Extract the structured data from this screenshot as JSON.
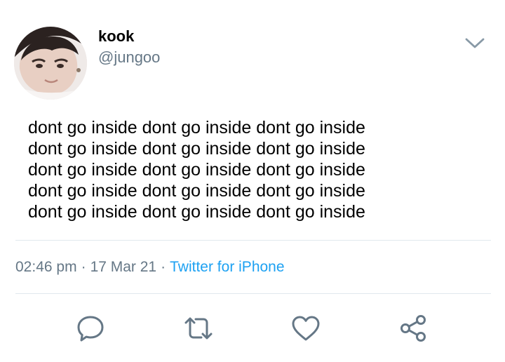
{
  "user": {
    "display_name": "kook",
    "handle": "@jungoo"
  },
  "tweet": {
    "lines": [
      "dont go inside dont go inside dont go inside",
      "dont go inside dont go inside dont go inside",
      "dont go inside dont go inside dont go inside",
      "dont go inside dont go inside dont go inside",
      "dont go inside dont go inside dont go inside"
    ],
    "time": "02:46 pm",
    "date": "17 Mar 21",
    "separator": "·",
    "source": "Twitter for iPhone"
  },
  "icons": {
    "menu": "chevron-down-icon",
    "reply": "reply-icon",
    "retweet": "retweet-icon",
    "like": "heart-icon",
    "share": "share-icon"
  },
  "colors": {
    "text": "#000000",
    "secondary": "#657786",
    "link": "#1da1f2",
    "divider": "#e1e8ed",
    "icon": "#657786"
  }
}
